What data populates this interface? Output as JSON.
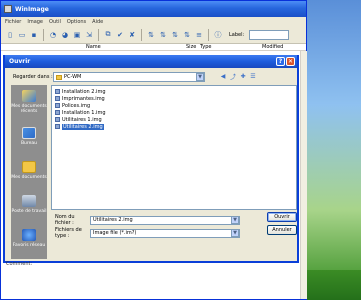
{
  "app": {
    "title": "WinImage",
    "menu": [
      "Fichier",
      "Image",
      "Outil",
      "Options",
      "Aide"
    ],
    "toolbar_label": "Label:",
    "columns": [
      "Name",
      "Size",
      "Type",
      "Modified"
    ]
  },
  "dialog": {
    "title": "Ouvrir",
    "look_in_label": "Regarder dans :",
    "look_in_value": "PC-WM",
    "files": [
      "Installation 2.img",
      "Imprimantes.img",
      "Polices.img",
      "Installation 1.img",
      "Utilitaires 1.img",
      "Utilitaires 2.img"
    ],
    "selected_index": 5,
    "places": [
      "Mes documents récents",
      "Bureau",
      "Mes documents",
      "Poste de travail",
      "Favoris réseau"
    ],
    "filename_label": "Nom du fichier :",
    "filename_value": "Utilitaires 2.img",
    "filetype_label": "Fichiers de type :",
    "filetype_value": "Image file (*.im?)",
    "open_button": "Ouvrir",
    "cancel_button": "Annuler",
    "comment_label": "Comment:"
  }
}
